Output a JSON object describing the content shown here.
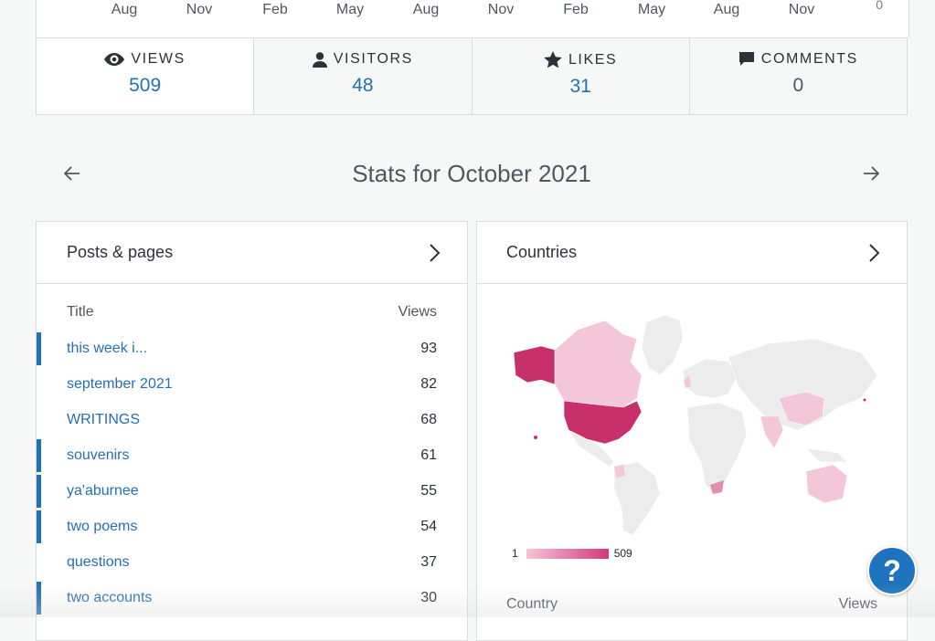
{
  "chart_axis": {
    "x_labels": [
      "Aug",
      "Nov",
      "Feb",
      "May",
      "Aug",
      "Nov",
      "Feb",
      "May",
      "Aug",
      "Nov"
    ],
    "y_min_label": "0"
  },
  "summary": {
    "tabs": [
      {
        "label": "VIEWS",
        "value": "509",
        "icon": "eye-icon"
      },
      {
        "label": "VISITORS",
        "value": "48",
        "icon": "person-icon"
      },
      {
        "label": "LIKES",
        "value": "31",
        "icon": "star-icon"
      },
      {
        "label": "COMMENTS",
        "value": "0",
        "icon": "comment-icon"
      }
    ]
  },
  "period": {
    "title": "Stats for October 2021"
  },
  "posts": {
    "title": "Posts & pages",
    "col_title": "Title",
    "col_views": "Views",
    "rows": [
      {
        "title": "this week i...",
        "views": "93",
        "bar": true
      },
      {
        "title": "september 2021",
        "views": "82",
        "bar": false
      },
      {
        "title": "WRITINGS",
        "views": "68",
        "bar": false
      },
      {
        "title": "souvenirs",
        "views": "61",
        "bar": true
      },
      {
        "title": "ya'aburnee",
        "views": "55",
        "bar": true
      },
      {
        "title": "two poems",
        "views": "54",
        "bar": true
      },
      {
        "title": "questions",
        "views": "37",
        "bar": false
      },
      {
        "title": "two accounts",
        "views": "30",
        "bar": true
      }
    ]
  },
  "countries": {
    "title": "Countries",
    "legend_min": "1",
    "legend_max": "509",
    "col_country": "Country",
    "col_views": "Views",
    "colors": {
      "high": "#c8306c",
      "mid": "#e08fb0",
      "low": "#f3c7d8",
      "none": "#ececec"
    }
  },
  "help": {
    "label": "?"
  }
}
